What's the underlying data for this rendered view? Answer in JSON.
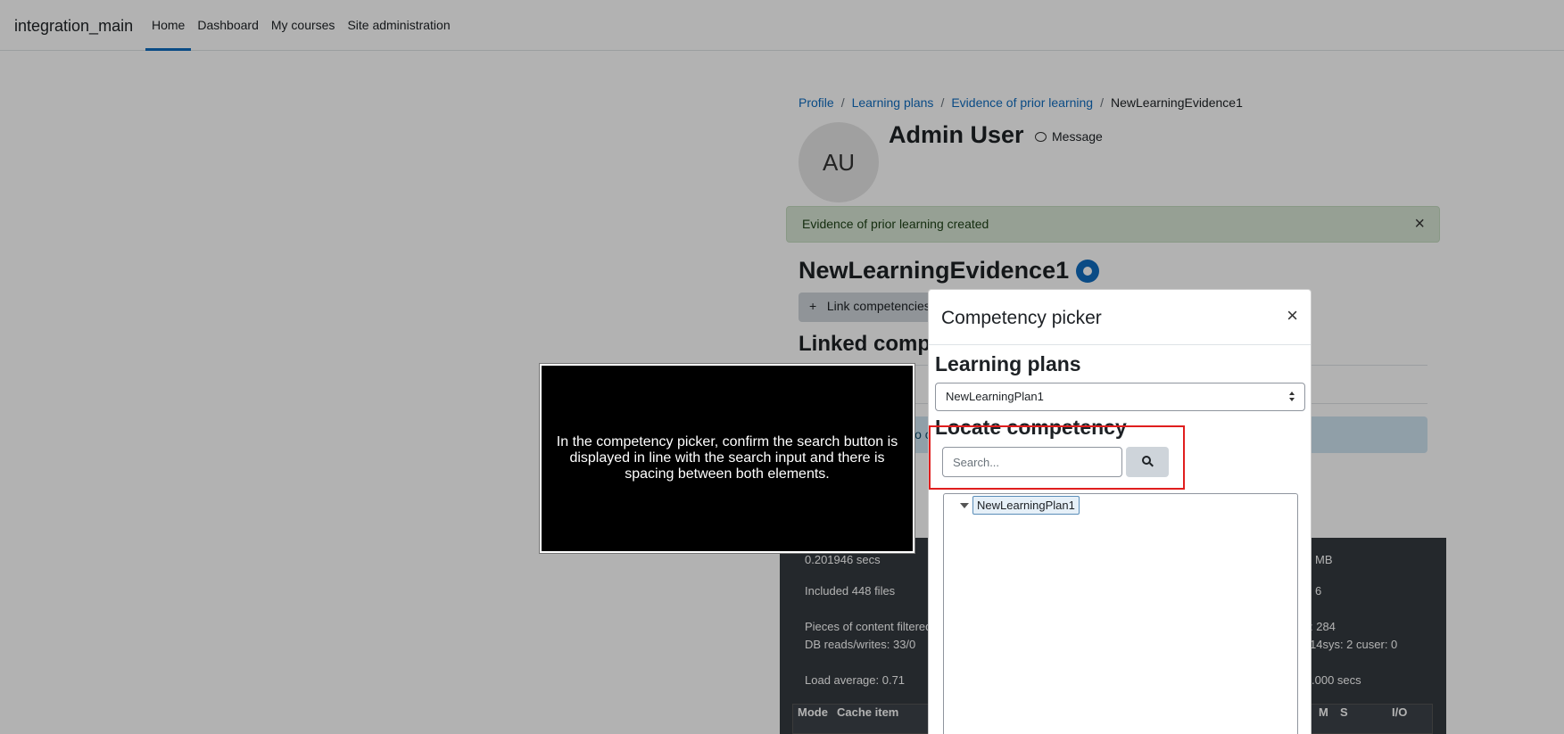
{
  "navbar": {
    "brand": "integration_main",
    "items": [
      {
        "label": "Home",
        "active": true
      },
      {
        "label": "Dashboard"
      },
      {
        "label": "My courses"
      },
      {
        "label": "Site administration"
      }
    ]
  },
  "breadcrumb": {
    "items": [
      "Profile",
      "Learning plans",
      "Evidence of prior learning"
    ],
    "current": "NewLearningEvidence1"
  },
  "user": {
    "initials": "AU",
    "name": "Admin User",
    "message_label": "Message"
  },
  "alert": {
    "text": "Evidence of prior learning created",
    "close": "×"
  },
  "evidence": {
    "title": "NewLearningEvidence1",
    "link_button": "Link competencies",
    "linked_heading": "Linked competencies",
    "info_text": "No competencies have been linked to this evidence"
  },
  "footer": {
    "time": "0.201946 secs",
    "files": "Included 448 files",
    "filtered": "Pieces of content filtered",
    "db": "DB reads/writes: 33/0",
    "load": "Load average: 0.71",
    "mem": "MB",
    "r6": "6",
    "r284": ": 284",
    "sys": "14sys: 2 cuser: 0",
    "secs": ".000 secs",
    "col_mode": "Mode",
    "col_cache": "Cache item",
    "col_m": "M",
    "col_s": "S",
    "col_io": "I/O"
  },
  "modal": {
    "title": "Competency picker",
    "close": "×",
    "learning_plans_heading": "Learning plans",
    "selected_plan": "NewLearningPlan1",
    "locate_heading": "Locate competency",
    "search_placeholder": "Search...",
    "tree_root": "NewLearningPlan1"
  },
  "instruction": {
    "text": "In the competency picker, confirm the search button is displayed in line with the search input and there is spacing between both elements."
  },
  "colors": {
    "primary": "#0f6cbf",
    "highlight": "#e01e1e",
    "alert_bg": "#d7e6d4",
    "footer_bg": "#343a40"
  }
}
